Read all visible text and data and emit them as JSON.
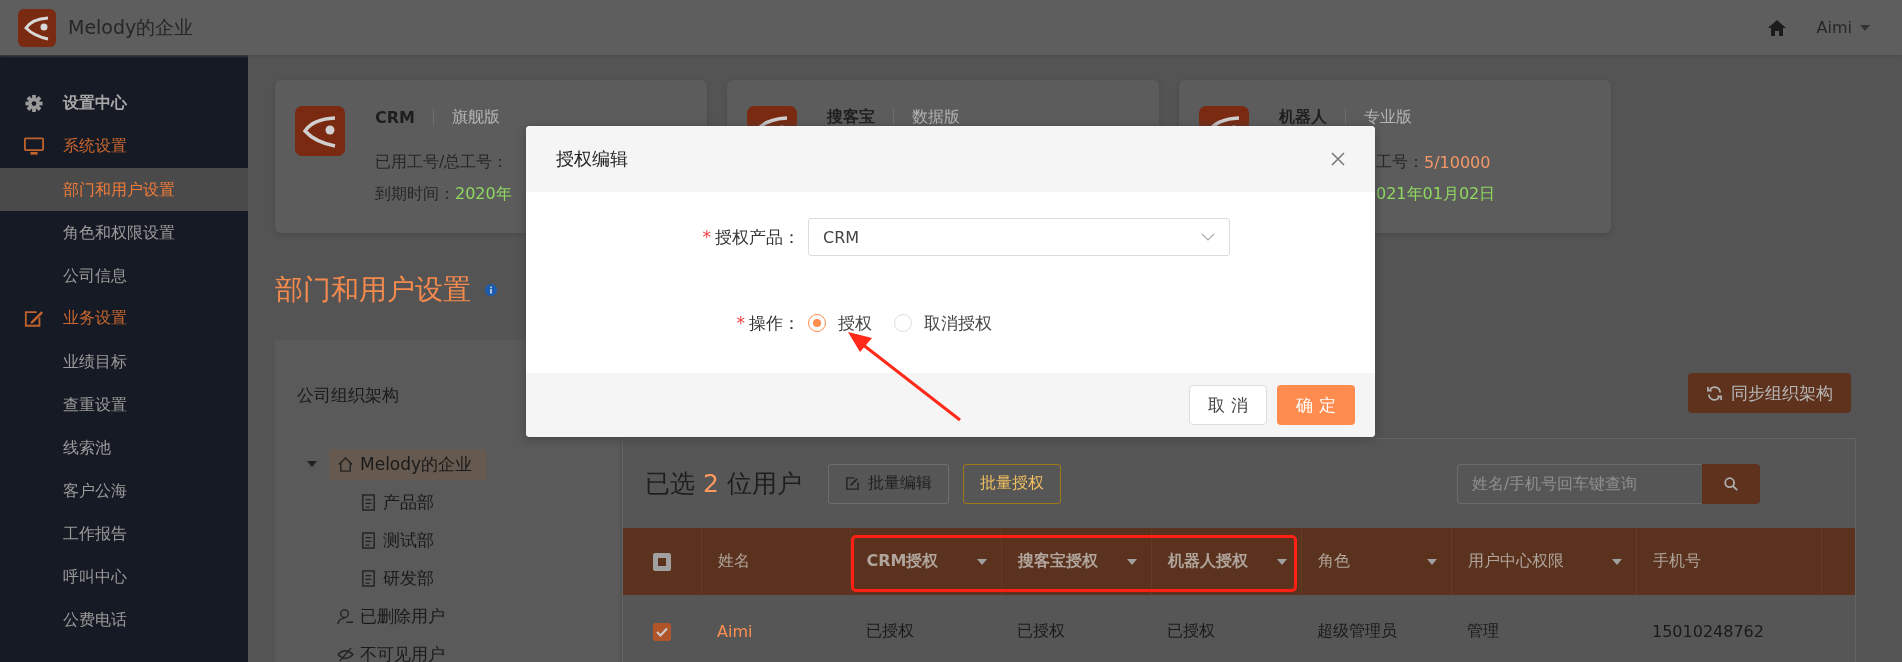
{
  "topbar": {
    "company": "Melody的企业",
    "user": "Aimi"
  },
  "sidebar": [
    {
      "kind": "heading",
      "label": "设置中心"
    },
    {
      "kind": "group",
      "label": "系统设置",
      "items": [
        {
          "label": "部门和用户设置",
          "selected": true
        },
        {
          "label": "角色和权限设置",
          "selected": false
        },
        {
          "label": "公司信息",
          "selected": false
        }
      ]
    },
    {
      "kind": "group",
      "label": "业务设置",
      "items": [
        {
          "label": "业绩目标",
          "selected": false
        },
        {
          "label": "查重设置",
          "selected": false
        },
        {
          "label": "线索池",
          "selected": false
        },
        {
          "label": "客户公海",
          "selected": false
        },
        {
          "label": "工作报告",
          "selected": false
        },
        {
          "label": "呼叫中心",
          "selected": false
        },
        {
          "label": "公费电话",
          "selected": false
        }
      ]
    }
  ],
  "products": [
    {
      "name": "CRM",
      "edition": "旗舰版",
      "stats": [
        {
          "label": "已用工号/总工号："
        },
        {
          "kind": "date",
          "label": "到期时间：",
          "value": "2020年"
        }
      ]
    },
    {
      "name": "搜客宝",
      "edition": "数据版"
    },
    {
      "name": "机器人",
      "edition": "专业版",
      "stats": [
        {
          "kind": "count",
          "label": "工号：",
          "value": "5/10000"
        },
        {
          "kind": "date",
          "value": "021年01月02日"
        }
      ]
    }
  ],
  "page_title": "部门和用户设置",
  "org_panel": {
    "title": "公司组织架构",
    "tree": [
      {
        "kind": "company",
        "label": "Melody的企业",
        "expanded": true,
        "selected": true,
        "children": [
          {
            "kind": "department",
            "label": "产品部",
            "selected": false
          },
          {
            "kind": "department",
            "label": "测试部",
            "selected": false
          },
          {
            "kind": "department",
            "label": "研发部",
            "selected": false
          }
        ]
      },
      {
        "kind": "deleted",
        "label": "已删除用户",
        "selected": false
      },
      {
        "kind": "hidden",
        "label": "不可见用户",
        "selected": false
      }
    ]
  },
  "sync_button": "同步组织架构",
  "toolbar": {
    "selected_prefix": "已选",
    "selected_count": "2",
    "selected_suffix": "位用户",
    "buttons": [
      {
        "kind": "edit",
        "label": "批量编辑"
      },
      {
        "kind": "outline",
        "label": "批量授权"
      }
    ],
    "search": {
      "placeholder": "姓名/手机号回车键查询"
    }
  },
  "table": {
    "header_checkbox": {
      "partial": true
    },
    "columns": [
      {
        "label": "姓名",
        "filter": false
      },
      {
        "label": "CRM授权",
        "filter": true
      },
      {
        "label": "搜客宝授权",
        "filter": true
      },
      {
        "label": "机器人授权",
        "filter": true
      },
      {
        "label": "角色",
        "filter": true
      },
      {
        "label": "用户中心权限",
        "filter": true
      },
      {
        "label": "手机号",
        "filter": false
      }
    ],
    "rows": [
      {
        "checked": true,
        "cells": [
          "Aimi",
          "已授权",
          "已授权",
          "已授权",
          "超级管理员",
          "管理",
          "15010248762"
        ]
      }
    ]
  },
  "dialog": {
    "title": "授权编辑",
    "fields": [
      {
        "kind": "select",
        "required_mark": "*",
        "label": "授权产品：",
        "value": "CRM"
      },
      {
        "kind": "radio",
        "required_mark": "*",
        "label": "操作：",
        "options": [
          {
            "label": "授权",
            "selected": true
          },
          {
            "label": "取消授权",
            "selected": false
          }
        ]
      }
    ],
    "buttons": [
      {
        "kind": "default",
        "label": "取 消"
      },
      {
        "kind": "primary",
        "label": "确 定"
      }
    ]
  }
}
